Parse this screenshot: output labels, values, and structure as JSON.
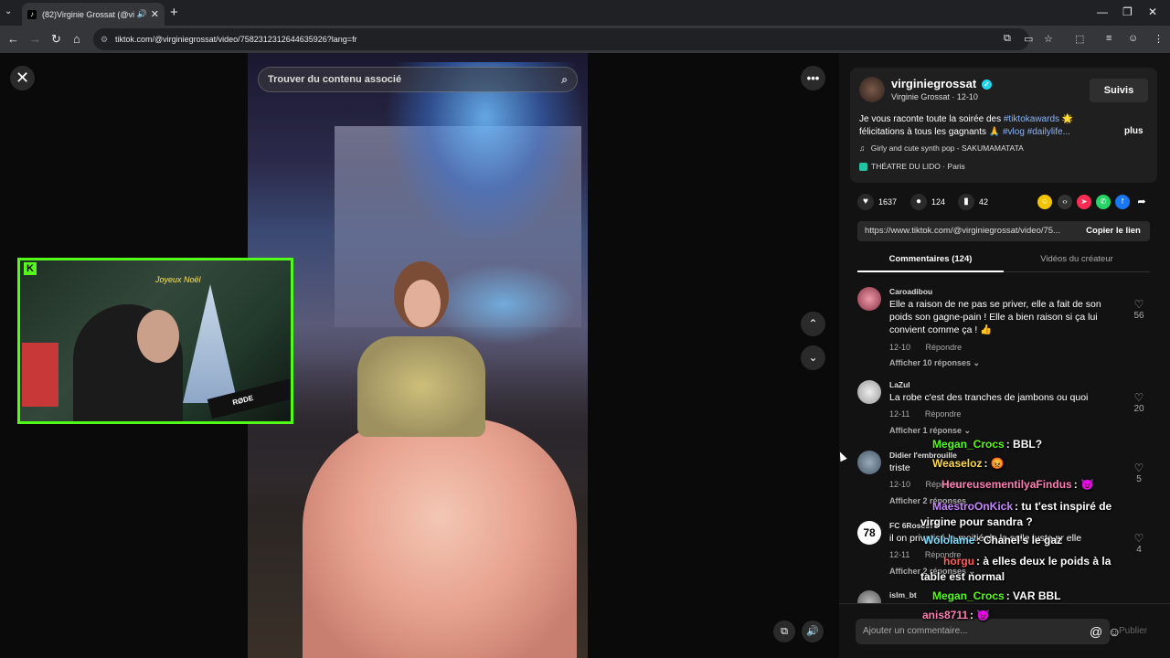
{
  "browser": {
    "tab_title": "(82)Virginie Grossat (@virgi",
    "url": "tiktok.com/@virginiegrossat/video/7582312312644635926?lang=fr",
    "new_tab": "+",
    "win_min": "—",
    "win_max": "❐",
    "win_close": "✕"
  },
  "video_view": {
    "search_placeholder": "Trouver du contenu associé",
    "close_icon": "✕",
    "more_icon": "•••",
    "up_icon": "⌃",
    "down_icon": "⌄"
  },
  "webcam": {
    "kick_logo": "K",
    "sign": "Joyeux Noël",
    "mic_brand": "RØDE"
  },
  "panel": {
    "username": "virginiegrossat",
    "display_name": "Virginie Grossat",
    "date": "12-10",
    "follow_label": "Suivis",
    "desc_text": "Je vous raconte toute la soirée des",
    "desc_tag1": "#tiktokawards",
    "desc_text2": "🌟 félicitations à tous les gagnants 🙏",
    "desc_tag2": "#vlog",
    "desc_tag3": "#dailylife...",
    "more_label": "plus",
    "music": "Girly and cute synth pop - SAKUMAMATATA",
    "location": "THÉATRE DU LIDO · Paris",
    "likes": "1637",
    "comments": "124",
    "saves": "42",
    "link": "https://www.tiktok.com/@virginiegrossat/video/75...",
    "copy_link": "Copier le lien",
    "tab_comments": "Commentaires (124)",
    "tab_creator": "Vidéos du créateur",
    "comment_placeholder": "Ajouter un commentaire...",
    "publish": "Publier"
  },
  "comments": [
    {
      "name": "Caroadibou",
      "text": "Elle a raison de ne pas se priver, elle a fait de son poids son gagne-pain ! Elle a bien raison si ça lui convient comme ça ! 👍",
      "date": "12-10",
      "reply": "Répondre",
      "likes": "56",
      "replies": "Afficher 10 réponses ⌄"
    },
    {
      "name": "LaZul",
      "text": "La robe c'est des tranches de jambons ou quoi",
      "date": "12-11",
      "reply": "Répondre",
      "likes": "20",
      "replies": "Afficher 1 réponse ⌄"
    },
    {
      "name": "Didier l'embrouille",
      "text": "triste",
      "date": "12-10",
      "reply": "Répondre",
      "likes": "5",
      "replies": "Afficher 2 réponses"
    },
    {
      "name": "FC 6Roses78",
      "text": "il on privatisé la moitié de la salle juste pr elle",
      "date": "12-11",
      "reply": "Répondre",
      "likes": "4",
      "replies": "Afficher 2 réponses ⌄"
    },
    {
      "name": "islm_bt",
      "text": ""
    }
  ],
  "chat": [
    {
      "user": "Megan_Crocs",
      "msg": ": BBL?",
      "color": "#53fc18"
    },
    {
      "user": "Weaseloz",
      "msg": ": 😡",
      "color": "#ffd84a"
    },
    {
      "user": "HeureusementilyaFindus",
      "msg": ": 😈",
      "color": "#ff7eb3"
    },
    {
      "user": "MaestroOnKick",
      "msg": ": tu t'est inspiré de",
      "color": "#c586ff"
    },
    {
      "user": "",
      "msg": "virgine pour sandra ?",
      "color": "#fff"
    },
    {
      "user": "Wololame",
      "msg": ": Chanel's le gaz",
      "color": "#7fdcff"
    },
    {
      "user": "horgu",
      "msg": ": à elles deux le poids à la",
      "color": "#ff5c5c"
    },
    {
      "user": "",
      "msg": "table est normal",
      "color": "#fff"
    },
    {
      "user": "Megan_Crocs",
      "msg": ": VAR BBL",
      "color": "#53fc18"
    },
    {
      "user": "anis8711",
      "msg": ": 😈",
      "color": "#ff7eb3"
    }
  ]
}
